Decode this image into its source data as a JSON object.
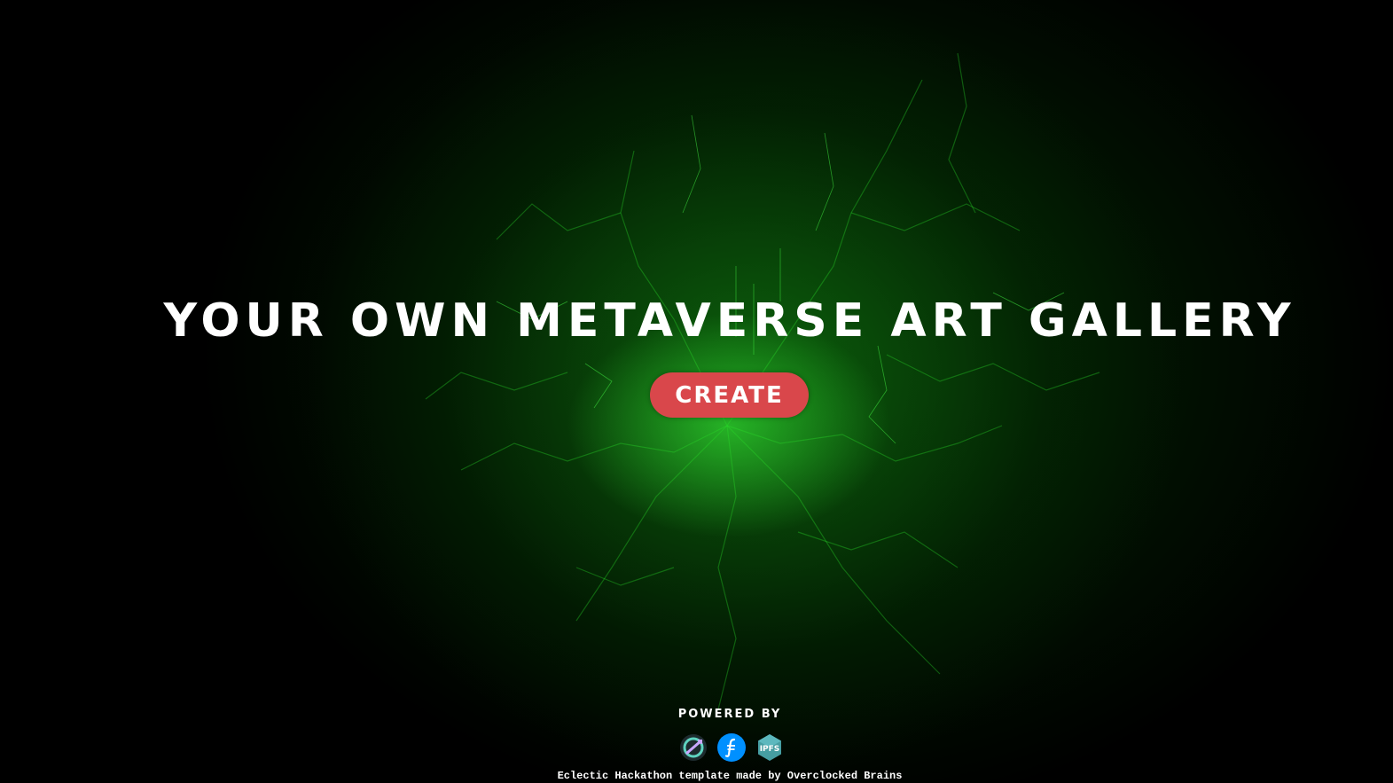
{
  "hero": {
    "title": "YOUR OWN METAVERSE ART GALLERY",
    "create_label": "CREATE"
  },
  "powered": {
    "label": "POWERED BY",
    "logos": [
      {
        "icon": "circular-arrows-logo-icon"
      },
      {
        "icon": "filecoin-logo-icon"
      },
      {
        "icon": "ipfs-logo-icon",
        "text": "IPFS"
      }
    ]
  },
  "footer": {
    "text": "Eclectic Hackathon template made by Overclocked Brains"
  },
  "colors": {
    "background": "#000000",
    "glow": "#22dd22",
    "button": "#d9474b",
    "text": "#ffffff"
  }
}
